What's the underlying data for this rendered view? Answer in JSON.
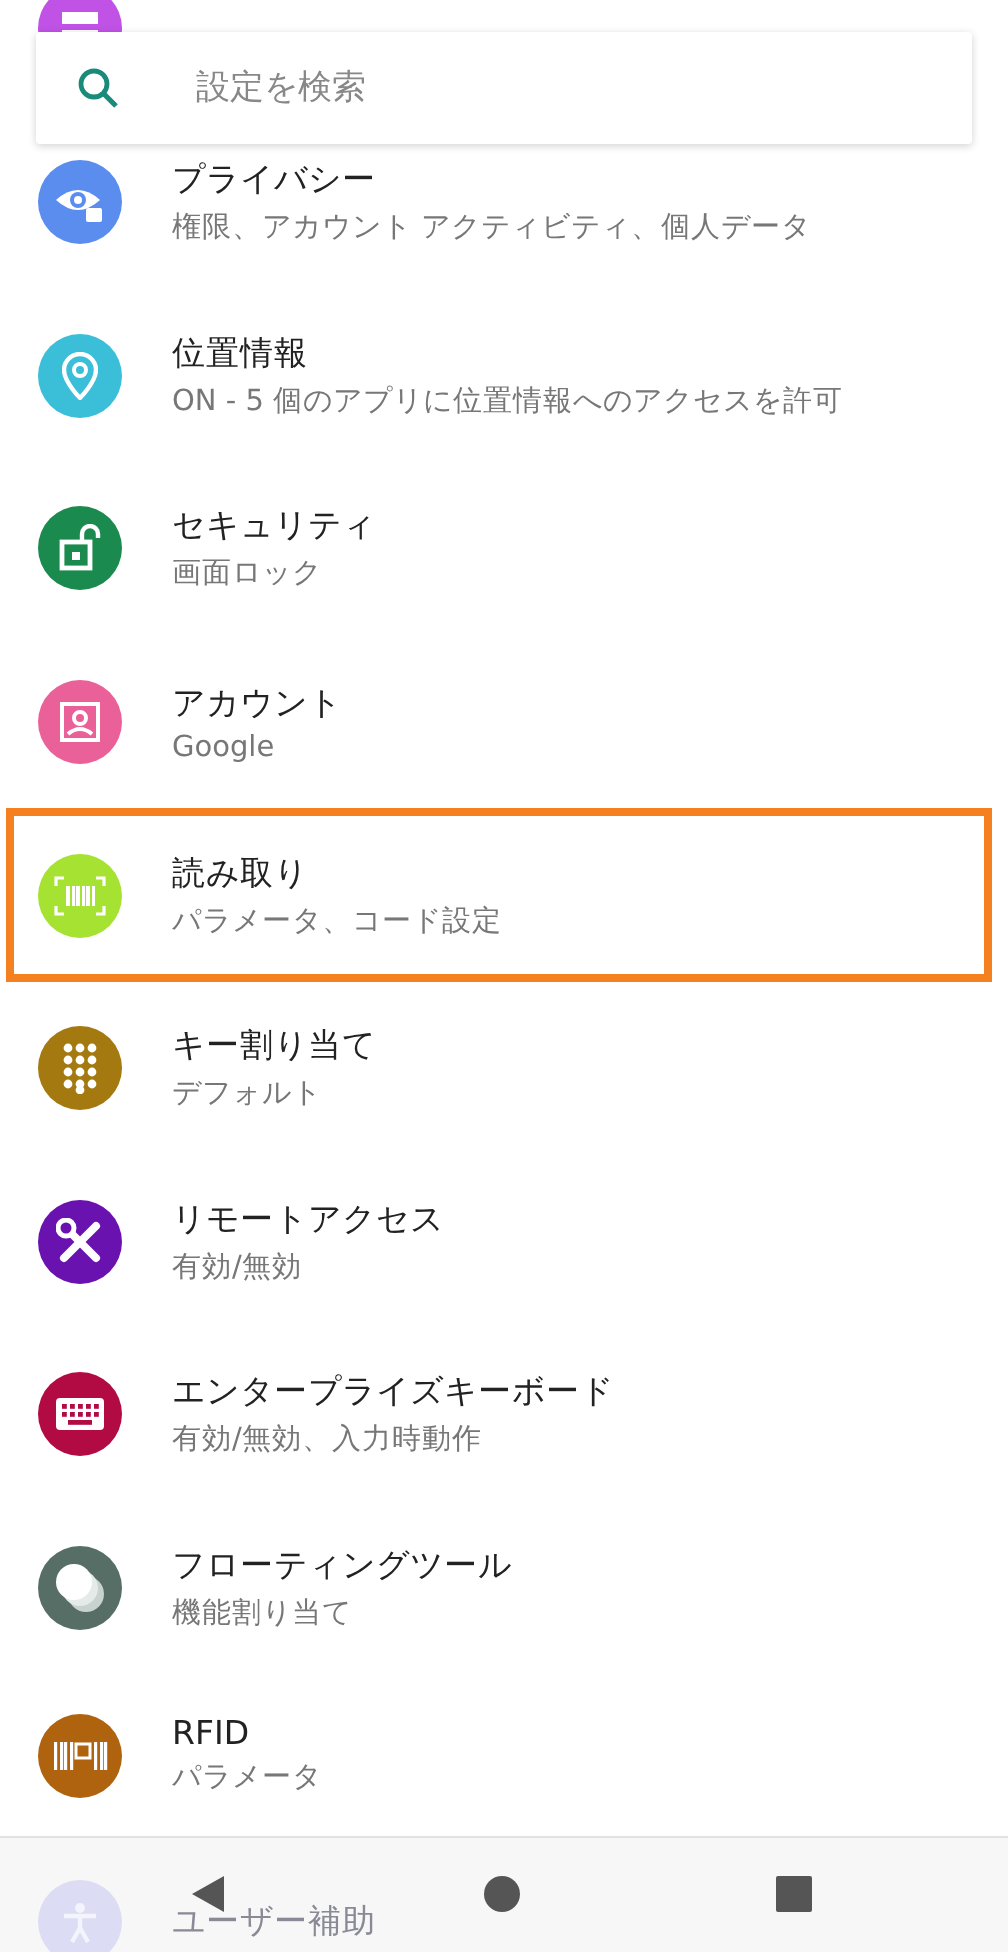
{
  "search": {
    "placeholder": "設定を検索"
  },
  "items": [
    {
      "kind": "storage",
      "color": "#c152e6",
      "clipped_top": true,
      "highlighted": false
    },
    {
      "kind": "privacy",
      "color": "#5b8def",
      "title": "プライバシー",
      "subtitle": "権限、アカウント アクティビティ、個人データ",
      "highlighted": false
    },
    {
      "kind": "location",
      "color": "#3bbfd9",
      "title": "位置情報",
      "subtitle": "ON - 5 個のアプリに位置情報へのアクセスを許可",
      "highlighted": false
    },
    {
      "kind": "security",
      "color": "#1b8a4f",
      "title": "セキュリティ",
      "subtitle": "画面ロック",
      "highlighted": false
    },
    {
      "kind": "account",
      "color": "#ea6199",
      "title": "アカウント",
      "subtitle": "Google",
      "highlighted": false
    },
    {
      "kind": "scan",
      "color": "#a6e232",
      "title": "読み取り",
      "subtitle": "パラメータ、コード設定",
      "highlighted": true
    },
    {
      "kind": "keys",
      "color": "#a37910",
      "title": "キー割り当て",
      "subtitle": "デフォルト",
      "highlighted": false
    },
    {
      "kind": "remote",
      "color": "#6a12b0",
      "title": "リモートアクセス",
      "subtitle": "有効/無効",
      "highlighted": false
    },
    {
      "kind": "keyboard",
      "color": "#b20b44",
      "title": "エンタープライズキーボード",
      "subtitle": "有効/無効、入力時動作",
      "highlighted": false
    },
    {
      "kind": "floating",
      "color": "#566e66",
      "title": "フローティングツール",
      "subtitle": "機能割り当て",
      "highlighted": false
    },
    {
      "kind": "rfid",
      "color": "#b0630f",
      "title": "RFID",
      "subtitle": "パラメータ",
      "highlighted": false
    },
    {
      "kind": "accessibility",
      "color": "#dcdcf4",
      "title": "ユーザー補助",
      "clipped_bottom": true,
      "highlighted": false
    }
  ],
  "nav": [
    {
      "kind": "back"
    },
    {
      "kind": "home"
    },
    {
      "kind": "recents"
    }
  ]
}
